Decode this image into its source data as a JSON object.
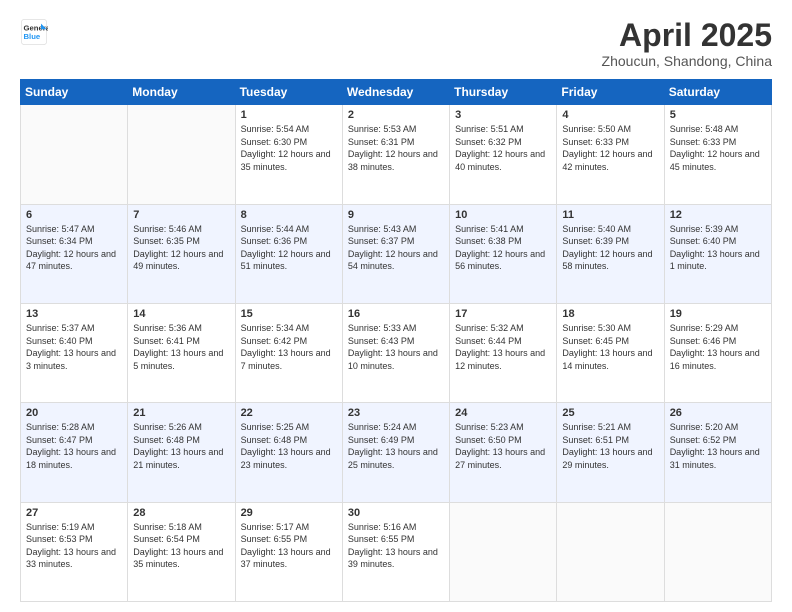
{
  "header": {
    "logo_line1": "General",
    "logo_line2": "Blue",
    "month_title": "April 2025",
    "location": "Zhoucun, Shandong, China"
  },
  "days_of_week": [
    "Sunday",
    "Monday",
    "Tuesday",
    "Wednesday",
    "Thursday",
    "Friday",
    "Saturday"
  ],
  "weeks": [
    [
      {
        "day": "",
        "sunrise": "",
        "sunset": "",
        "daylight": ""
      },
      {
        "day": "",
        "sunrise": "",
        "sunset": "",
        "daylight": ""
      },
      {
        "day": "1",
        "sunrise": "Sunrise: 5:54 AM",
        "sunset": "Sunset: 6:30 PM",
        "daylight": "Daylight: 12 hours and 35 minutes."
      },
      {
        "day": "2",
        "sunrise": "Sunrise: 5:53 AM",
        "sunset": "Sunset: 6:31 PM",
        "daylight": "Daylight: 12 hours and 38 minutes."
      },
      {
        "day": "3",
        "sunrise": "Sunrise: 5:51 AM",
        "sunset": "Sunset: 6:32 PM",
        "daylight": "Daylight: 12 hours and 40 minutes."
      },
      {
        "day": "4",
        "sunrise": "Sunrise: 5:50 AM",
        "sunset": "Sunset: 6:33 PM",
        "daylight": "Daylight: 12 hours and 42 minutes."
      },
      {
        "day": "5",
        "sunrise": "Sunrise: 5:48 AM",
        "sunset": "Sunset: 6:33 PM",
        "daylight": "Daylight: 12 hours and 45 minutes."
      }
    ],
    [
      {
        "day": "6",
        "sunrise": "Sunrise: 5:47 AM",
        "sunset": "Sunset: 6:34 PM",
        "daylight": "Daylight: 12 hours and 47 minutes."
      },
      {
        "day": "7",
        "sunrise": "Sunrise: 5:46 AM",
        "sunset": "Sunset: 6:35 PM",
        "daylight": "Daylight: 12 hours and 49 minutes."
      },
      {
        "day": "8",
        "sunrise": "Sunrise: 5:44 AM",
        "sunset": "Sunset: 6:36 PM",
        "daylight": "Daylight: 12 hours and 51 minutes."
      },
      {
        "day": "9",
        "sunrise": "Sunrise: 5:43 AM",
        "sunset": "Sunset: 6:37 PM",
        "daylight": "Daylight: 12 hours and 54 minutes."
      },
      {
        "day": "10",
        "sunrise": "Sunrise: 5:41 AM",
        "sunset": "Sunset: 6:38 PM",
        "daylight": "Daylight: 12 hours and 56 minutes."
      },
      {
        "day": "11",
        "sunrise": "Sunrise: 5:40 AM",
        "sunset": "Sunset: 6:39 PM",
        "daylight": "Daylight: 12 hours and 58 minutes."
      },
      {
        "day": "12",
        "sunrise": "Sunrise: 5:39 AM",
        "sunset": "Sunset: 6:40 PM",
        "daylight": "Daylight: 13 hours and 1 minute."
      }
    ],
    [
      {
        "day": "13",
        "sunrise": "Sunrise: 5:37 AM",
        "sunset": "Sunset: 6:40 PM",
        "daylight": "Daylight: 13 hours and 3 minutes."
      },
      {
        "day": "14",
        "sunrise": "Sunrise: 5:36 AM",
        "sunset": "Sunset: 6:41 PM",
        "daylight": "Daylight: 13 hours and 5 minutes."
      },
      {
        "day": "15",
        "sunrise": "Sunrise: 5:34 AM",
        "sunset": "Sunset: 6:42 PM",
        "daylight": "Daylight: 13 hours and 7 minutes."
      },
      {
        "day": "16",
        "sunrise": "Sunrise: 5:33 AM",
        "sunset": "Sunset: 6:43 PM",
        "daylight": "Daylight: 13 hours and 10 minutes."
      },
      {
        "day": "17",
        "sunrise": "Sunrise: 5:32 AM",
        "sunset": "Sunset: 6:44 PM",
        "daylight": "Daylight: 13 hours and 12 minutes."
      },
      {
        "day": "18",
        "sunrise": "Sunrise: 5:30 AM",
        "sunset": "Sunset: 6:45 PM",
        "daylight": "Daylight: 13 hours and 14 minutes."
      },
      {
        "day": "19",
        "sunrise": "Sunrise: 5:29 AM",
        "sunset": "Sunset: 6:46 PM",
        "daylight": "Daylight: 13 hours and 16 minutes."
      }
    ],
    [
      {
        "day": "20",
        "sunrise": "Sunrise: 5:28 AM",
        "sunset": "Sunset: 6:47 PM",
        "daylight": "Daylight: 13 hours and 18 minutes."
      },
      {
        "day": "21",
        "sunrise": "Sunrise: 5:26 AM",
        "sunset": "Sunset: 6:48 PM",
        "daylight": "Daylight: 13 hours and 21 minutes."
      },
      {
        "day": "22",
        "sunrise": "Sunrise: 5:25 AM",
        "sunset": "Sunset: 6:48 PM",
        "daylight": "Daylight: 13 hours and 23 minutes."
      },
      {
        "day": "23",
        "sunrise": "Sunrise: 5:24 AM",
        "sunset": "Sunset: 6:49 PM",
        "daylight": "Daylight: 13 hours and 25 minutes."
      },
      {
        "day": "24",
        "sunrise": "Sunrise: 5:23 AM",
        "sunset": "Sunset: 6:50 PM",
        "daylight": "Daylight: 13 hours and 27 minutes."
      },
      {
        "day": "25",
        "sunrise": "Sunrise: 5:21 AM",
        "sunset": "Sunset: 6:51 PM",
        "daylight": "Daylight: 13 hours and 29 minutes."
      },
      {
        "day": "26",
        "sunrise": "Sunrise: 5:20 AM",
        "sunset": "Sunset: 6:52 PM",
        "daylight": "Daylight: 13 hours and 31 minutes."
      }
    ],
    [
      {
        "day": "27",
        "sunrise": "Sunrise: 5:19 AM",
        "sunset": "Sunset: 6:53 PM",
        "daylight": "Daylight: 13 hours and 33 minutes."
      },
      {
        "day": "28",
        "sunrise": "Sunrise: 5:18 AM",
        "sunset": "Sunset: 6:54 PM",
        "daylight": "Daylight: 13 hours and 35 minutes."
      },
      {
        "day": "29",
        "sunrise": "Sunrise: 5:17 AM",
        "sunset": "Sunset: 6:55 PM",
        "daylight": "Daylight: 13 hours and 37 minutes."
      },
      {
        "day": "30",
        "sunrise": "Sunrise: 5:16 AM",
        "sunset": "Sunset: 6:55 PM",
        "daylight": "Daylight: 13 hours and 39 minutes."
      },
      {
        "day": "",
        "sunrise": "",
        "sunset": "",
        "daylight": ""
      },
      {
        "day": "",
        "sunrise": "",
        "sunset": "",
        "daylight": ""
      },
      {
        "day": "",
        "sunrise": "",
        "sunset": "",
        "daylight": ""
      }
    ]
  ]
}
